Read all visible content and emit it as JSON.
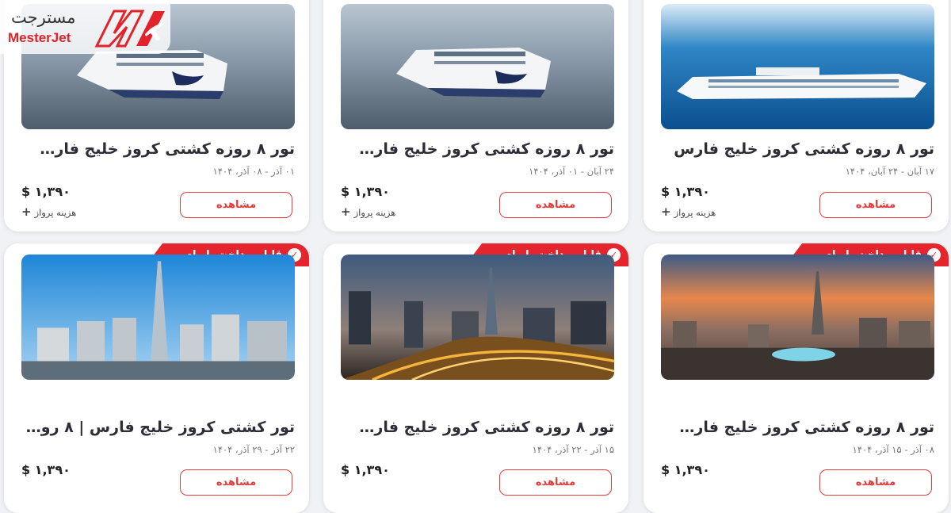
{
  "brand": {
    "name_fa": "مسترجت",
    "name_en": "MesterJet",
    "color": "#e2232b"
  },
  "common": {
    "view_label": "مشاهده",
    "flight_cost": "هزینه پرواز",
    "installment_label": "قابل پرداخت با وام",
    "check_icon": "check-icon"
  },
  "cards": [
    {
      "title": "تور ۸ روزه کشتی کروز خلیج فارس ...",
      "dates": "۰۱ آذر - ۰۸ آذر، ۱۴۰۴",
      "price": "$ ۱,۳۹۰",
      "flight": "هزینه پرواز",
      "view": "مشاهده"
    },
    {
      "title": "تور ۸ روزه کشتی کروز خلیج فارس ...",
      "dates": "۲۴ آبان - ۰۱ آذر، ۱۴۰۴",
      "price": "$ ۱,۳۹۰",
      "flight": "هزینه پرواز",
      "view": "مشاهده"
    },
    {
      "title": "تور ۸ روزه کشتی کروز خلیج فارس",
      "dates": "۱۷ آبان - ۲۴ آبان، ۱۴۰۴",
      "price": "$ ۱,۳۹۰",
      "flight": "هزینه پرواز",
      "view": "مشاهده"
    },
    {
      "title": "تور کشتی کروز خلیج فارس | ۸ روز...",
      "dates": "۲۲ آذر - ۲۹ آذر، ۱۴۰۴",
      "price": "$ ۱,۳۹۰",
      "badge": "قابل پرداخت با وام",
      "view": "مشاهده"
    },
    {
      "title": "تور ۸ روزه کشتی کروز خلیج فارس ...",
      "dates": "۱۵ آذر - ۲۲ آذر، ۱۴۰۴",
      "price": "$ ۱,۳۹۰",
      "badge": "قابل پرداخت با وام",
      "view": "مشاهده"
    },
    {
      "title": "تور ۸ روزه کشتی کروز خلیج فارس ...",
      "dates": "۰۸ آذر - ۱۵ آذر، ۱۴۰۴",
      "price": "$ ۱,۳۹۰",
      "badge": "قابل پرداخت با وام",
      "view": "مشاهده"
    }
  ]
}
